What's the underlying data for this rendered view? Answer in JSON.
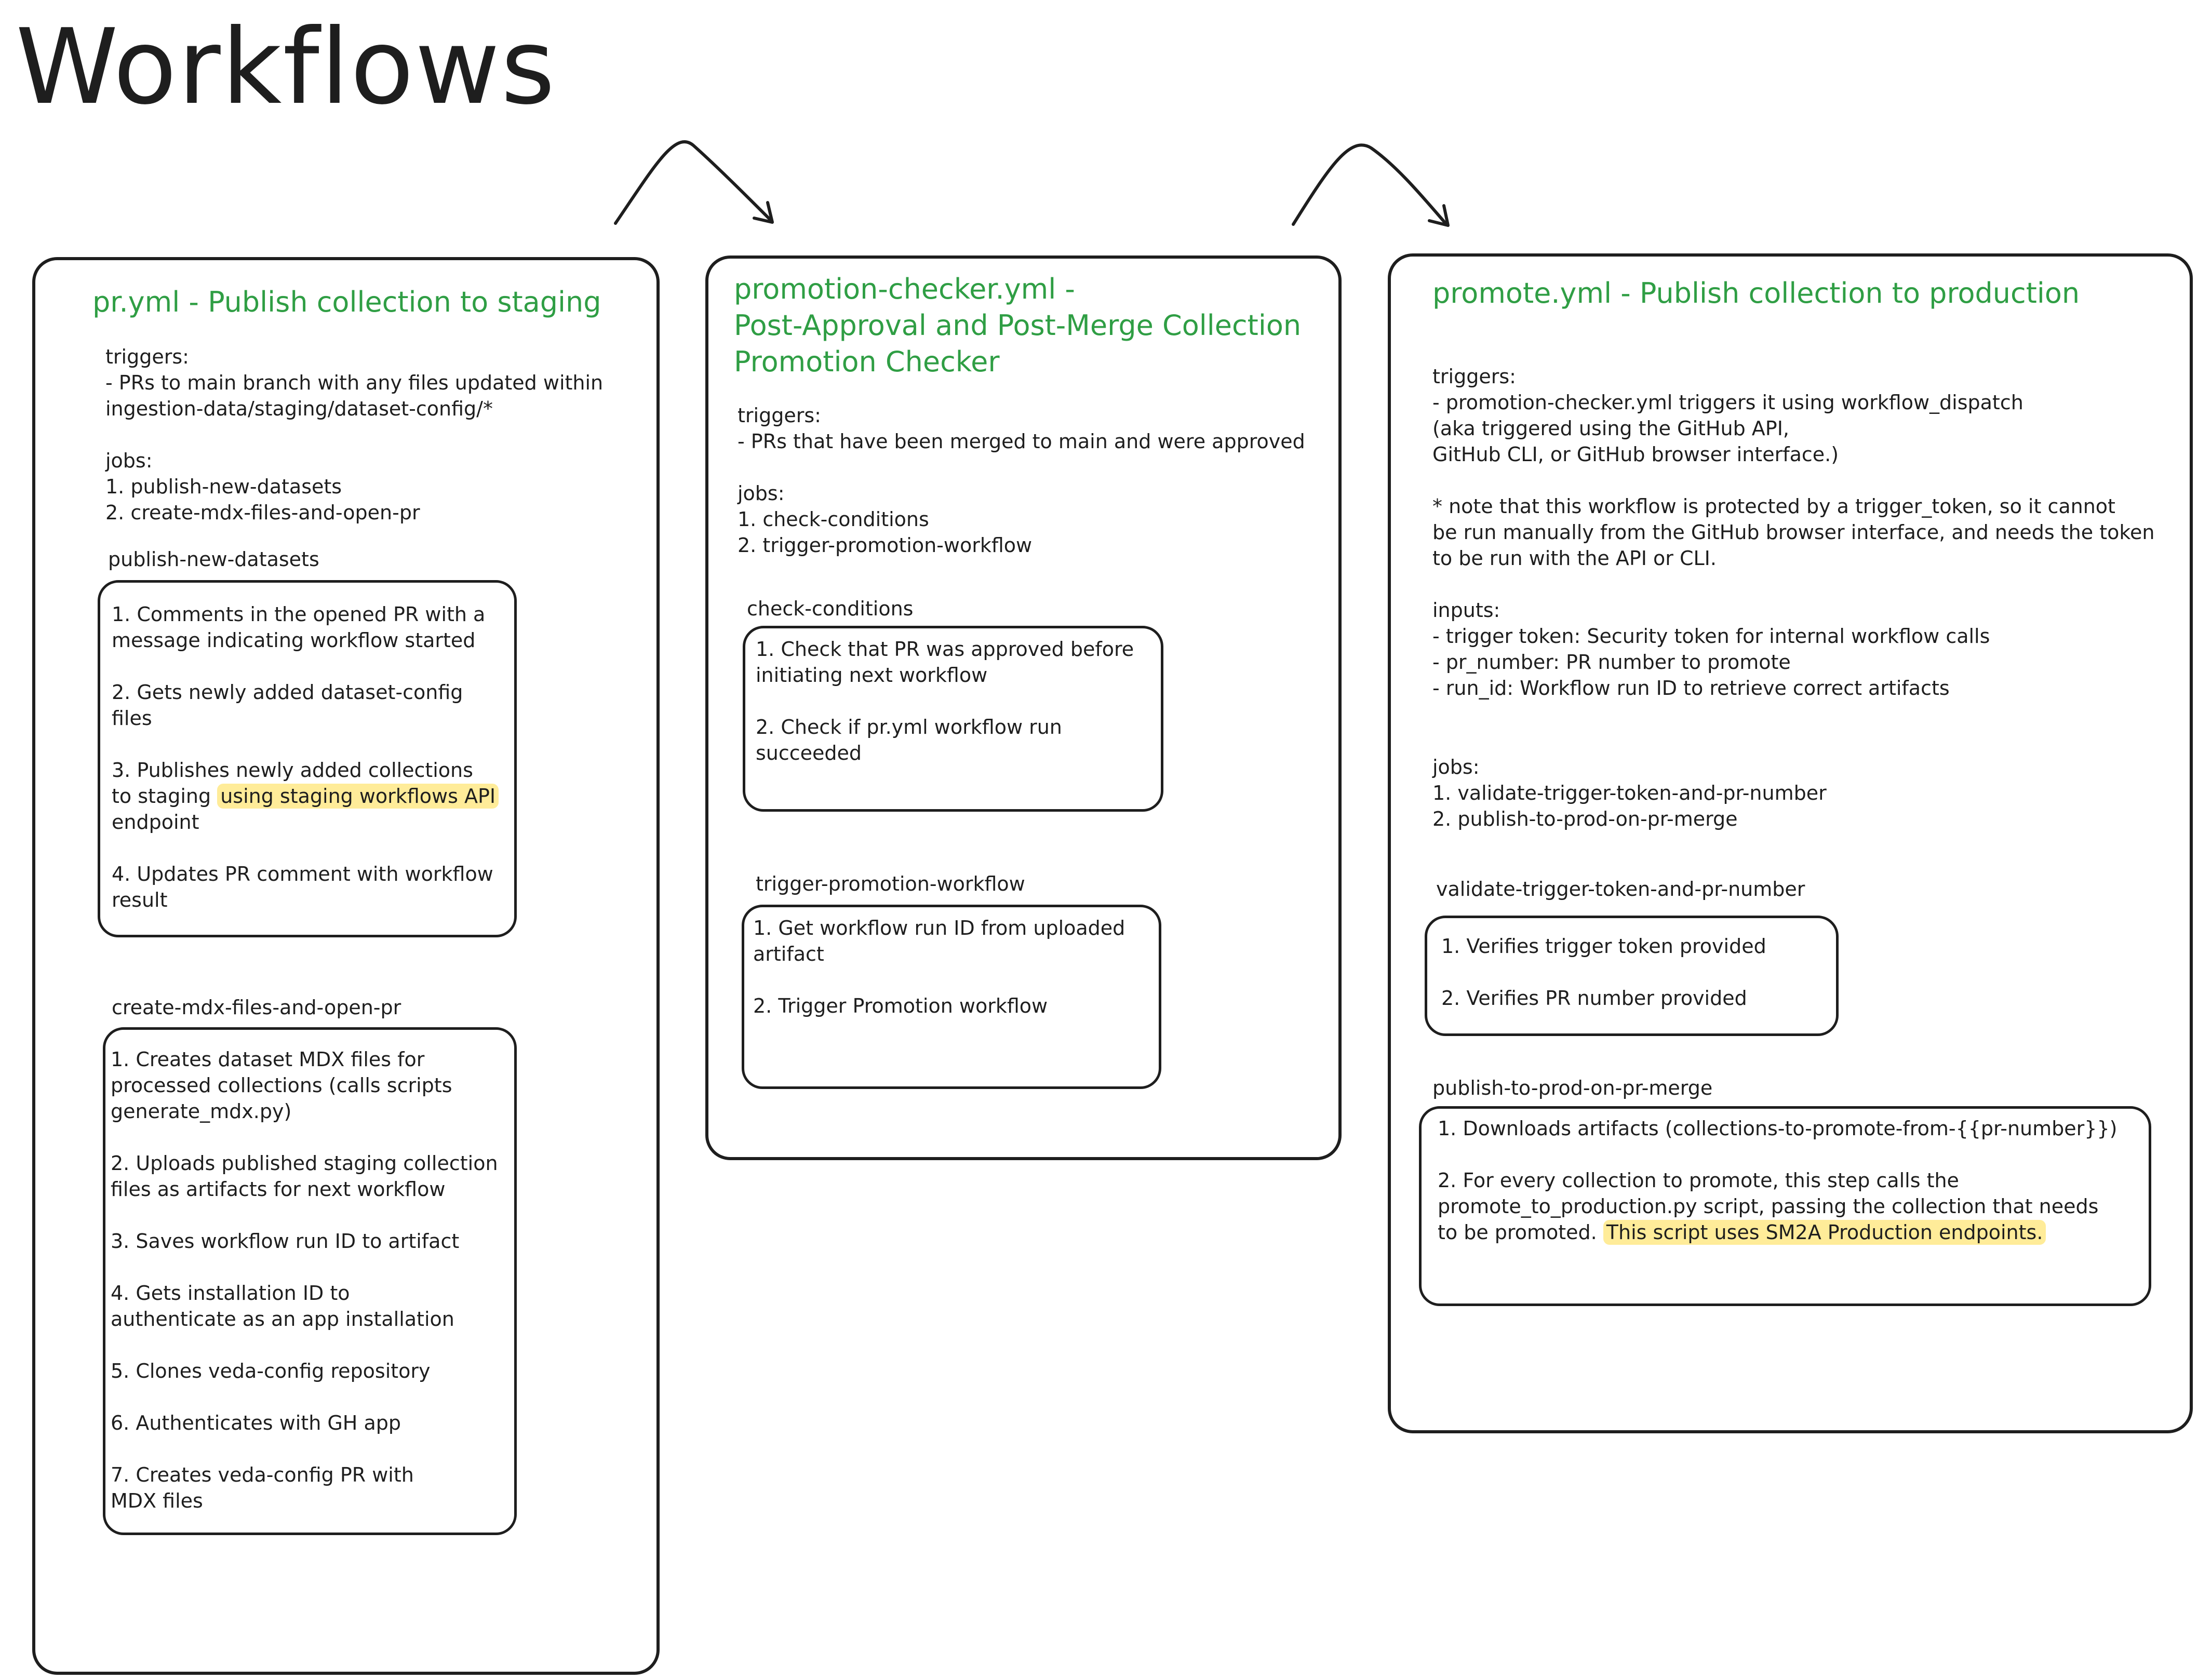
{
  "title": "Workflows",
  "panel1": {
    "title": "pr.yml - Publish collection to staging",
    "triggers_label": "triggers:",
    "triggers_lines": [
      "- PRs to main branch with any files updated within",
      "ingestion-data/staging/dataset-config/*"
    ],
    "jobs_label": "jobs:",
    "jobs_lines": [
      "1. publish-new-datasets",
      "2. create-mdx-files-and-open-pr"
    ],
    "job1_label": "publish-new-datasets",
    "job1_steps": {
      "s1_a": "1. Comments in the opened PR with a",
      "s1_b": "message indicating workflow started",
      "s2_a": "2. Gets newly added dataset-config",
      "s2_b": "files",
      "s3_a": "3. Publishes newly added collections",
      "s3_b_pre": "to staging ",
      "s3_b_hl": "using staging workflows API",
      "s3_c": "endpoint",
      "s4_a": "4. Updates PR comment with workflow",
      "s4_b": "result"
    },
    "job2_label": "create-mdx-files-and-open-pr",
    "job2_steps": {
      "s1_a": "1. Creates dataset MDX files for",
      "s1_b": "processed collections (calls scripts",
      "s1_c": "generate_mdx.py)",
      "s2_a": "2. Uploads published staging collection",
      "s2_b": "files as artifacts for next workflow",
      "s3_a": "3. Saves workflow run ID to artifact",
      "s4_a": "4. Gets installation ID to",
      "s4_b": "authenticate as an app installation",
      "s5_a": "5. Clones veda-config repository",
      "s6_a": "6. Authenticates with GH app",
      "s7_a": "7. Creates veda-config PR with",
      "s7_b": "MDX files"
    }
  },
  "panel2": {
    "title_lines": [
      "promotion-checker.yml -",
      "Post-Approval and Post-Merge Collection",
      "Promotion Checker"
    ],
    "triggers_label": "triggers:",
    "triggers_lines": [
      "- PRs that have been merged to main and were approved"
    ],
    "jobs_label": "jobs:",
    "jobs_lines": [
      "1. check-conditions",
      "2. trigger-promotion-workflow"
    ],
    "job1_label": "check-conditions",
    "job1_steps": {
      "s1_a": "1. Check that PR was approved before",
      "s1_b": "initiating next workflow",
      "s2_a": "2. Check if pr.yml workflow run",
      "s2_b": "succeeded"
    },
    "job2_label": "trigger-promotion-workflow",
    "job2_steps": {
      "s1_a": "1. Get workflow run ID from uploaded",
      "s1_b": "artifact",
      "s2_a": "2. Trigger Promotion workflow"
    }
  },
  "panel3": {
    "title": "promote.yml - Publish collection to production",
    "triggers_label": "triggers:",
    "triggers_lines": [
      "- promotion-checker.yml triggers it using workflow_dispatch",
      "(aka triggered using the GitHub API,",
      "GitHub CLI, or GitHub browser interface.)"
    ],
    "note_lines": [
      "* note that this workflow is protected by a trigger_token, so it cannot",
      "be run manually from the GitHub browser interface, and needs the token",
      "to be run with the API or CLI."
    ],
    "inputs_label": "inputs:",
    "inputs_lines": [
      "- trigger token: Security token for internal workflow calls",
      "- pr_number: PR number to promote",
      "- run_id: Workflow run ID to retrieve correct artifacts"
    ],
    "jobs_label": "jobs:",
    "jobs_lines": [
      "1. validate-trigger-token-and-pr-number",
      "2. publish-to-prod-on-pr-merge"
    ],
    "job1_label": "validate-trigger-token-and-pr-number",
    "job1_steps": {
      "s1_a": "1. Verifies trigger token provided",
      "s2_a": "2. Verifies PR number provided"
    },
    "job2_label": "publish-to-prod-on-pr-merge",
    "job2_steps": {
      "s1_a": "1. Downloads artifacts (collections-to-promote-from-{{pr-number}})",
      "s2_a": "2. For every collection to promote, this step calls the",
      "s2_b": "promote_to_production.py script, passing the collection that needs",
      "s2_c_pre": "to be promoted. ",
      "s2_c_hl": "This script uses SM2A Production endpoints."
    }
  },
  "colors": {
    "stroke": "#1e1e1e",
    "title_green": "#2f9e44",
    "highlight": "#ffec99"
  }
}
